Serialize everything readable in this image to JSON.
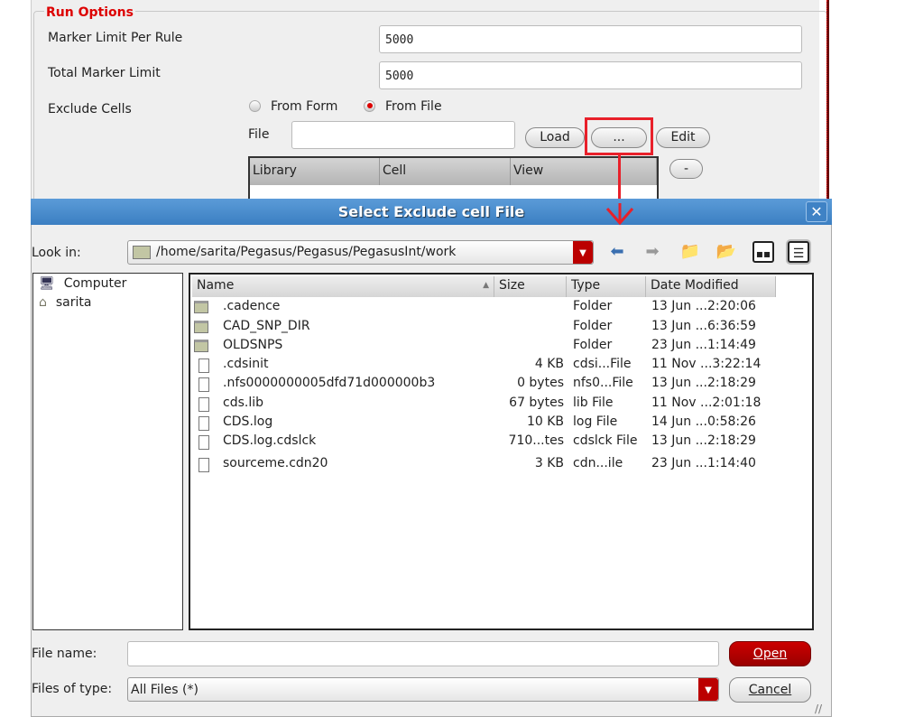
{
  "run_options": {
    "legend": "Run Options",
    "marker_limit_label": "Marker Limit Per Rule",
    "marker_limit_value": "5000",
    "total_limit_label": "Total Marker Limit",
    "total_limit_value": "5000",
    "exclude_label": "Exclude Cells",
    "radio_form": "From Form",
    "radio_file": "From File",
    "file_label": "File",
    "file_value": "",
    "load": "Load",
    "browse": "...",
    "edit": "Edit",
    "remove": "-",
    "columns": [
      "Library",
      "Cell",
      "View"
    ]
  },
  "dialog": {
    "title": "Select Exclude cell File",
    "close": "✕",
    "look_in_label": "Look in:",
    "look_in_value": "/home/sarita/Pegasus/Pegasus/PegasusInt/work",
    "places": [
      "Computer",
      "sarita"
    ],
    "columns": [
      "Name",
      "Size",
      "Type",
      "Date Modified"
    ],
    "files": [
      {
        "name": ".cadence",
        "size": "",
        "type": "Folder",
        "date": "13 Jun ...2:20:06",
        "kind": "folder"
      },
      {
        "name": "CAD_SNP_DIR",
        "size": "",
        "type": "Folder",
        "date": "13 Jun ...6:36:59",
        "kind": "folder"
      },
      {
        "name": "OLDSNPS",
        "size": "",
        "type": "Folder",
        "date": "23 Jun ...1:14:49",
        "kind": "folder"
      },
      {
        "name": ".cdsinit",
        "size": "4 KB",
        "type": "cdsi...File",
        "date": "11 Nov ...3:22:14",
        "kind": "link"
      },
      {
        "name": ".nfs0000000005dfd71d000000b3",
        "size": "0 bytes",
        "type": "nfs0...File",
        "date": "13 Jun ...2:18:29",
        "kind": "file"
      },
      {
        "name": "cds.lib",
        "size": "67 bytes",
        "type": "lib File",
        "date": "11 Nov ...2:01:18",
        "kind": "file"
      },
      {
        "name": "CDS.log",
        "size": "10 KB",
        "type": "log File",
        "date": "14 Jun ...0:58:26",
        "kind": "file"
      },
      {
        "name": "CDS.log.cdslck",
        "size": "710...tes",
        "type": "cdslck File",
        "date": "13 Jun ...2:18:29",
        "kind": "file"
      },
      {
        "name": "sourceme.cdn20",
        "size": "3 KB",
        "type": "cdn...ile",
        "date": "23 Jun ...1:14:40",
        "kind": "link"
      }
    ],
    "file_name_label": "File name:",
    "file_name_value": "",
    "files_of_type_label": "Files of type:",
    "files_of_type_value": "All Files (*)",
    "open": "Open",
    "cancel": "Cancel"
  }
}
